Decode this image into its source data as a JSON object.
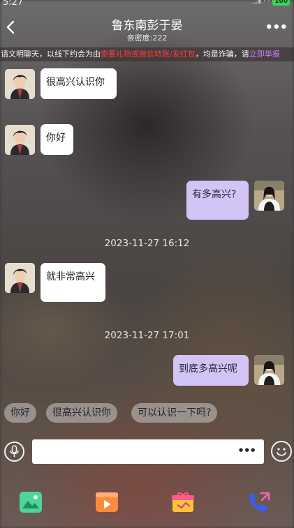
{
  "status": {
    "time": "5:27",
    "signal": "...ıll",
    "battery": "100"
  },
  "header": {
    "title": "鲁东南彭于晏",
    "subtitle": "亲密度:222"
  },
  "notice": {
    "part1": "请文明聊天，以线下约会为由",
    "part2": "索要礼物或微信转账/发红包",
    "part3": "，均是诈骗，请",
    "part4": "立即举报"
  },
  "messages": [
    {
      "side": "left",
      "text": "很高兴认识你"
    },
    {
      "side": "left",
      "text": "你好"
    },
    {
      "side": "right",
      "text": "有多高兴?"
    },
    {
      "type": "time",
      "text": "2023-11-27 16:12"
    },
    {
      "side": "left",
      "text": "就非常高兴"
    },
    {
      "type": "time",
      "text": "2023-11-27 17:01"
    },
    {
      "side": "right",
      "text": "到底多高兴呢"
    }
  ],
  "quick_replies": [
    "你好",
    "很高兴认识你",
    "可以认识一下吗?"
  ],
  "input": {
    "more": "•••"
  },
  "toolbar": {
    "items": [
      "photo-icon",
      "video-icon",
      "gift-icon",
      "phone-icon"
    ]
  },
  "colors": {
    "right_bubble": "#d2c4f5",
    "left_bubble": "#ffffff",
    "warning": "#ff3b3b",
    "report_link": "#c981ff"
  }
}
